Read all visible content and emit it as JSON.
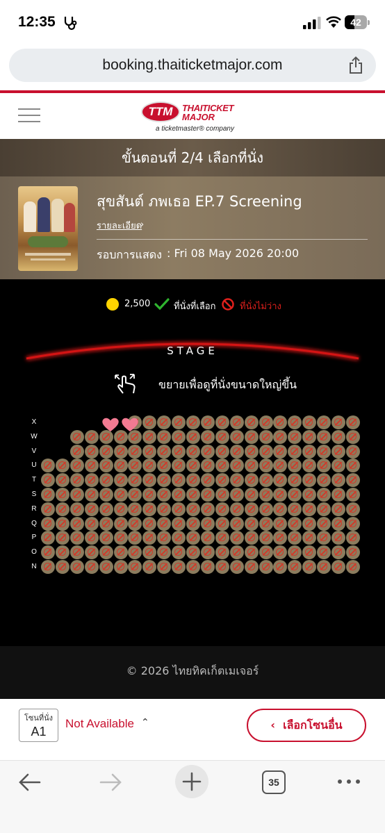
{
  "status_bar": {
    "time": "12:35",
    "battery": "42"
  },
  "browser": {
    "url": "booking.thaiticketmajor.com",
    "tab_count": "35"
  },
  "site": {
    "logo_mark": "TTM",
    "logo_line1": "THAITICKET",
    "logo_line2": "MAJOR",
    "logo_sub": "a ticketmaster® company"
  },
  "step": {
    "label": "ขั้นตอนที่ 2/4 เลือกที่นั่ง"
  },
  "event": {
    "title": "สุขสันต์ ภพเธอ EP.7 Screening",
    "detail_link": "รายละเอียด",
    "showtime_label": "รอบการแสดง",
    "showtime_value": ": Fri 08 May 2026 20:00"
  },
  "legend": {
    "price": "2,500",
    "selected_label": "ที่นั่งที่เลือก",
    "unavailable_label": "ที่นั่งไม่ว่าง",
    "colors": {
      "price": "#ffd400",
      "selected": "#2fb52f",
      "unavailable": "#e1201c"
    }
  },
  "stage": {
    "label": "STAGE",
    "zoom_hint": "ขยายเพื่อดูที่นั่งขนาดใหญ่ขึ้น"
  },
  "seat_rows": [
    {
      "label": "X",
      "first_col": 7,
      "last_col": 22,
      "status": "unavailable"
    },
    {
      "label": "W",
      "first_col": 3,
      "last_col": 22,
      "status": "unavailable"
    },
    {
      "label": "V",
      "first_col": 3,
      "last_col": 22,
      "status": "unavailable"
    },
    {
      "label": "U",
      "first_col": 1,
      "last_col": 22,
      "status": "unavailable"
    },
    {
      "label": "T",
      "first_col": 1,
      "last_col": 22,
      "status": "unavailable"
    },
    {
      "label": "S",
      "first_col": 1,
      "last_col": 22,
      "status": "unavailable"
    },
    {
      "label": "R",
      "first_col": 1,
      "last_col": 22,
      "status": "unavailable"
    },
    {
      "label": "Q",
      "first_col": 1,
      "last_col": 22,
      "status": "unavailable"
    },
    {
      "label": "P",
      "first_col": 1,
      "last_col": 22,
      "status": "unavailable"
    },
    {
      "label": "O",
      "first_col": 1,
      "last_col": 22,
      "status": "unavailable"
    },
    {
      "label": "N",
      "first_col": 1,
      "last_col": 22,
      "status": "unavailable"
    }
  ],
  "footer": {
    "copyright": "© 2026 ไทยทิคเก็ตเมเจอร์"
  },
  "zone": {
    "label": "โซนที่นั่ง",
    "value": "A1",
    "status": "Not Available",
    "other_button": "เลือกโซนอื่น"
  }
}
